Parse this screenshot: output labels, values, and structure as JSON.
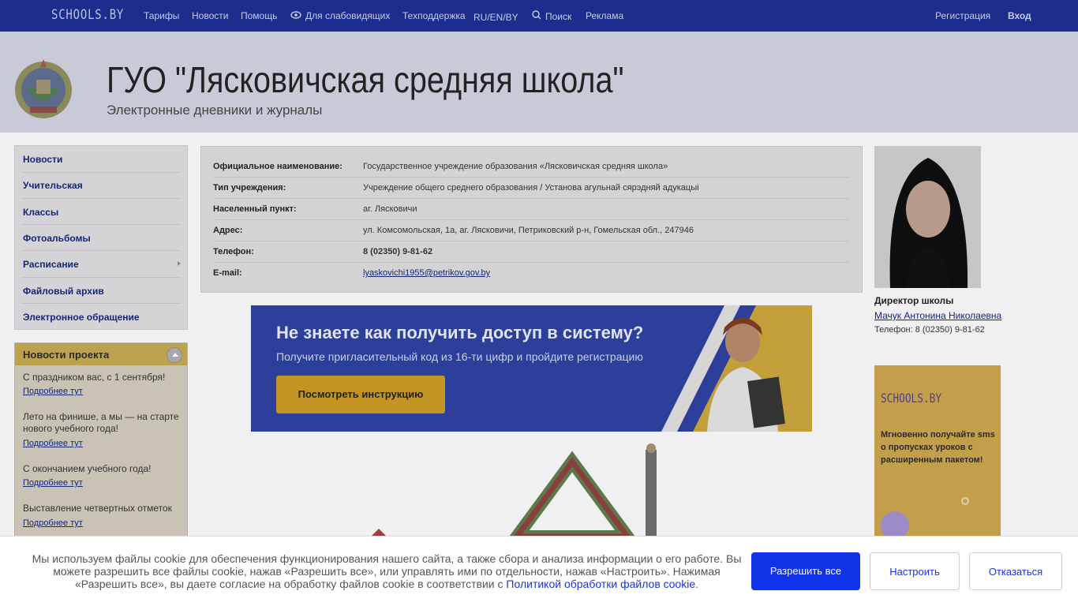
{
  "topbar": {
    "logo": "SCHOOLS.BY",
    "nav": [
      "Тарифы",
      "Новости",
      "Помощь",
      "Для слабовидящих",
      "Техподдержка",
      "RU/EN/BY",
      "Поиск",
      "Реклама"
    ],
    "register": "Регистрация",
    "login": "Вход"
  },
  "header": {
    "title": "ГУО \"Лясковичская средняя школа\"",
    "subtitle": "Электронные дневники и журналы"
  },
  "menu": [
    "Новости",
    "Учительская",
    "Классы",
    "Фотоальбомы",
    "Расписание",
    "Файловый архив",
    "Электронное обращение"
  ],
  "news": {
    "title": "Новости проекта",
    "items": [
      {
        "text": "С праздником вас, с 1 сентября!",
        "link": "Подробнее тут"
      },
      {
        "text": "Лето на финише, а мы — на старте нового учебного года!",
        "link": "Подробнее тут"
      },
      {
        "text": "С окончанием учебного года!",
        "link": "Подробнее тут"
      },
      {
        "text": "Выставление четвертных отметок",
        "link": "Подробнее тут"
      }
    ]
  },
  "info": [
    {
      "label": "Официальное наименование:",
      "value": "Государственное учреждение образования «Лясковичская средняя школа»"
    },
    {
      "label": "Тип учреждения:",
      "value": "Учреждение общего среднего образования / Установа агульнай сярэдняй адукацыі"
    },
    {
      "label": "Населенный пункт:",
      "value": "аг. Лясковичи"
    },
    {
      "label": "Адрес:",
      "value": "ул. Комсомольская, 1а, аг. Лясковичи, Петриковский р-н, Гомельская обл., 247946"
    },
    {
      "label": "Телефон:",
      "value": "8 (02350) 9-81-62"
    },
    {
      "label": "E-mail:",
      "value": "lyaskovichi1955@petrikov.gov.by"
    }
  ],
  "banner": {
    "title": "Не знаете как получить доступ в систему?",
    "subtitle": "Получите пригласительный код из 16-ти цифр и пройдите регистрацию",
    "button": "Посмотреть инструкцию"
  },
  "director": {
    "role": "Директор школы",
    "name": "Мачук Антонина Николаевна",
    "phone": "Телефон: 8 (02350) 9-81-62"
  },
  "ad": {
    "logo": "SCHOOLS.BY",
    "text": "Мгновенно получайте sms о пропусках уроков с расширенным пакетом!"
  },
  "cookie": {
    "text": "Мы используем файлы cookie для обеспечения функционирования нашего сайта, а также сбора и анализа информации о его работе. Вы можете разрешить все файлы cookie, нажав «Разрешить все», или управлять ими по отдельности, нажав «Настроить». Нажимая «Разрешить все», вы даете согласие на обработку файлов cookie в соответствии с",
    "link": "Политикой обработки файлов cookie",
    "allow": "Разрешить все",
    "settings": "Настроить",
    "deny": "Отказаться"
  }
}
